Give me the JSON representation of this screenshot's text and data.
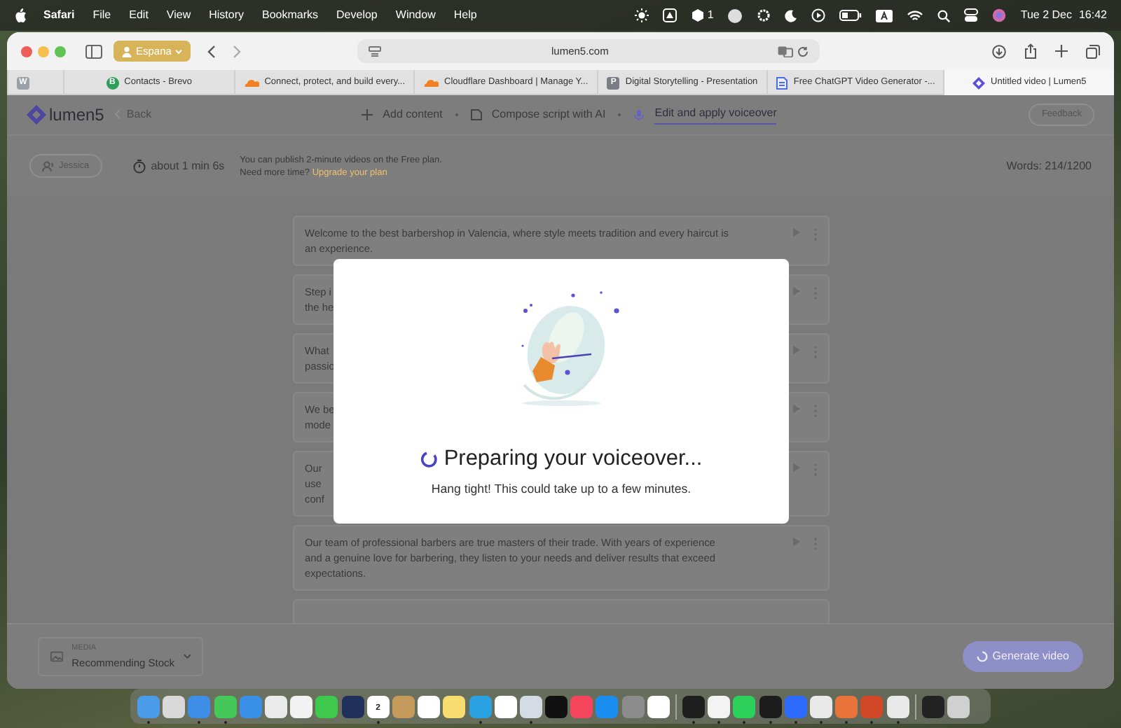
{
  "menu_bar": {
    "app": "Safari",
    "menus": [
      "File",
      "Edit",
      "View",
      "History",
      "Bookmarks",
      "Develop",
      "Window",
      "Help"
    ],
    "status_count": "1",
    "date": "Tue 2 Dec",
    "time": "16:42"
  },
  "browser": {
    "profile": "Espana",
    "address": "lumen5.com",
    "tabs": [
      {
        "kind": "letter",
        "favicon_text": "W",
        "selected": false
      },
      {
        "kind": "letter",
        "favicon_text": "B",
        "title": "Contacts - Brevo",
        "selected": false
      },
      {
        "kind": "cloud",
        "title": "Connect, protect, and build every...",
        "selected": false
      },
      {
        "kind": "cloud",
        "title": "Cloudflare Dashboard | Manage Y...",
        "selected": false
      },
      {
        "kind": "letter",
        "favicon_text": "P",
        "title": "Digital Storytelling - Presentation",
        "selected": false
      },
      {
        "kind": "doc",
        "title": "Free ChatGPT Video Generator -...",
        "selected": false
      },
      {
        "kind": "logo",
        "title": "Untitled video | Lumen5",
        "selected": true
      }
    ]
  },
  "app": {
    "logo": "lumen5",
    "back": "Back",
    "steps": [
      {
        "label": "Add content",
        "selected": false
      },
      {
        "label": "Compose script with AI",
        "selected": false
      },
      {
        "label": "Edit and apply voiceover",
        "selected": true
      }
    ],
    "feedback": "Feedback",
    "voice": "Jessica",
    "duration": "about 1 min 6s",
    "notice": "You can publish 2-minute videos on the Free plan.",
    "notice_question": "Need more time?",
    "upgrade_link": "Upgrade your plan",
    "words": "Words: 214/1200",
    "paragraphs": [
      {
        "lines": [
          "Welcome to the best barbershop in Valencia, where style meets tradition and every haircut is",
          "an experience."
        ]
      },
      {
        "lines": [
          "Step i",
          "the he"
        ]
      },
      {
        "lines": [
          "What",
          "passio"
        ]
      },
      {
        "lines": [
          "We be",
          "mode"
        ]
      },
      {
        "lines": [
          "Our",
          "use",
          "conf"
        ]
      },
      {
        "lines": [
          "Our team of professional barbers are true masters of their trade. With years of experience",
          "and a genuine love for barbering, they listen to your needs and deliver results that exceed",
          "expectations."
        ]
      }
    ],
    "paragraph_cut_off_below": true,
    "media_label": "MEDIA",
    "media_value": "Recommending Stock",
    "generate": {
      "label": "Generate video",
      "disabled": true
    }
  },
  "modal": {
    "title": "Preparing your voiceover...",
    "message": "Hang tight! This could take up to a few minutes."
  },
  "dock": [
    {
      "running": true
    },
    {
      "running": false
    },
    {
      "running": true
    },
    {
      "running": true
    },
    {
      "running": false
    },
    {
      "running": false
    },
    {
      "running": false
    },
    {
      "running": false
    },
    {
      "running": false
    },
    {
      "running": true,
      "label": "2"
    },
    {
      "running": false
    },
    {
      "running": false
    },
    {
      "running": false
    },
    {
      "running": true
    },
    {
      "running": false
    },
    {
      "running": true
    },
    {
      "running": false
    },
    {
      "running": false
    },
    {
      "running": false
    },
    {
      "running": false
    },
    {
      "running": false
    },
    {
      "running": true
    },
    {
      "running": true
    },
    {
      "running": true
    },
    {
      "running": true
    },
    {
      "running": true
    },
    {
      "running": true
    },
    {
      "running": true
    },
    {
      "running": true
    },
    {
      "running": true
    },
    {
      "running": false
    },
    {
      "running": false
    }
  ]
}
